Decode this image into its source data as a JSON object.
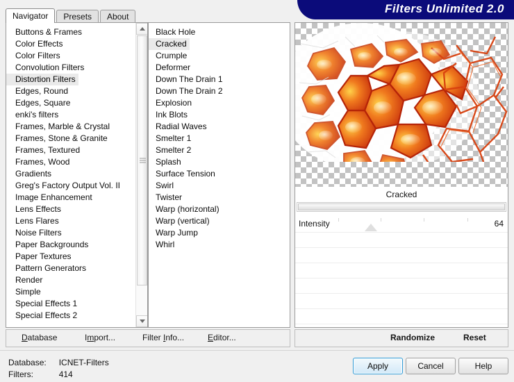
{
  "window": {
    "banner_title": "Filters Unlimited 2.0"
  },
  "tabs": [
    {
      "label": "Navigator",
      "active": true
    },
    {
      "label": "Presets",
      "active": false
    },
    {
      "label": "About",
      "active": false
    }
  ],
  "categories": {
    "selected": "Distortion Filters",
    "items": [
      "Buttons & Frames",
      "Color Effects",
      "Color Filters",
      "Convolution Filters",
      "Distortion Filters",
      "Edges, Round",
      "Edges, Square",
      "enki's filters",
      "Frames, Marble & Crystal",
      "Frames, Stone & Granite",
      "Frames, Textured",
      "Frames, Wood",
      "Gradients",
      "Greg's Factory Output Vol. II",
      "Image Enhancement",
      "Lens Effects",
      "Lens Flares",
      "Noise Filters",
      "Paper Backgrounds",
      "Paper Textures",
      "Pattern Generators",
      "Render",
      "Simple",
      "Special Effects 1",
      "Special Effects 2"
    ]
  },
  "filters": {
    "selected": "Cracked",
    "items": [
      "Black Hole",
      "Cracked",
      "Crumple",
      "Deformer",
      "Down The Drain 1",
      "Down The Drain 2",
      "Explosion",
      "Ink Blots",
      "Radial Waves",
      "Smelter 1",
      "Smelter 2",
      "Splash",
      "Surface Tension",
      "Swirl",
      "Twister",
      "Warp (horizontal)",
      "Warp (vertical)",
      "Warp Jump",
      "Whirl"
    ]
  },
  "preview": {
    "filter_name": "Cracked"
  },
  "parameters": [
    {
      "name": "Intensity",
      "value": "64",
      "percent": 25
    },
    {
      "name": "",
      "value": "",
      "percent": null
    },
    {
      "name": "",
      "value": "",
      "percent": null
    },
    {
      "name": "",
      "value": "",
      "percent": null
    },
    {
      "name": "",
      "value": "",
      "percent": null
    },
    {
      "name": "",
      "value": "",
      "percent": null
    },
    {
      "name": "",
      "value": "",
      "percent": null
    }
  ],
  "toolbar_left": {
    "database": {
      "pre": "",
      "key": "D",
      "post": "atabase"
    },
    "import": {
      "pre": "I",
      "key": "m",
      "post": "port..."
    },
    "filter_info": {
      "pre": "Filter ",
      "key": "I",
      "post": "nfo..."
    },
    "editor": {
      "pre": "",
      "key": "E",
      "post": "ditor..."
    }
  },
  "toolbar_right": {
    "randomize": "Randomize",
    "reset": "Reset"
  },
  "status": {
    "database_label": "Database:",
    "database_value": "ICNET-Filters",
    "filters_label": "Filters:",
    "filters_value": "414"
  },
  "dialog_buttons": {
    "apply": "Apply",
    "cancel": "Cancel",
    "help": "Help"
  },
  "colors": {
    "banner": "#0b0b7a",
    "selection": "#eaeaea",
    "default_button_border": "#2d9ad6"
  }
}
